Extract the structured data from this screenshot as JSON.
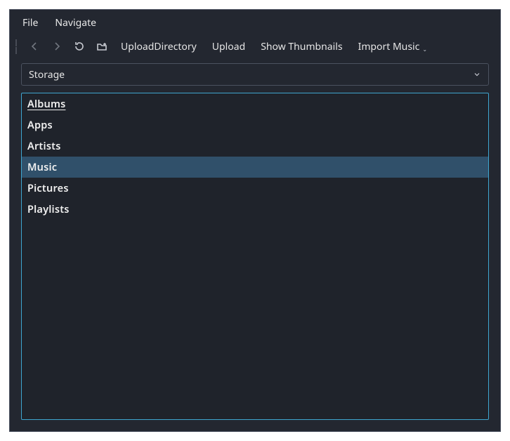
{
  "menubar": {
    "file": "File",
    "navigate": "Navigate"
  },
  "toolbar": {
    "upload_directory": "UploadDirectory",
    "upload": "Upload",
    "show_thumbnails": "Show Thumbnails",
    "import_music": "Import Music"
  },
  "combo": {
    "value": "Storage"
  },
  "list": {
    "items": [
      {
        "label": "Albums"
      },
      {
        "label": "Apps"
      },
      {
        "label": "Artists"
      },
      {
        "label": "Music"
      },
      {
        "label": "Pictures"
      },
      {
        "label": "Playlists"
      }
    ],
    "selected_index": 3
  }
}
